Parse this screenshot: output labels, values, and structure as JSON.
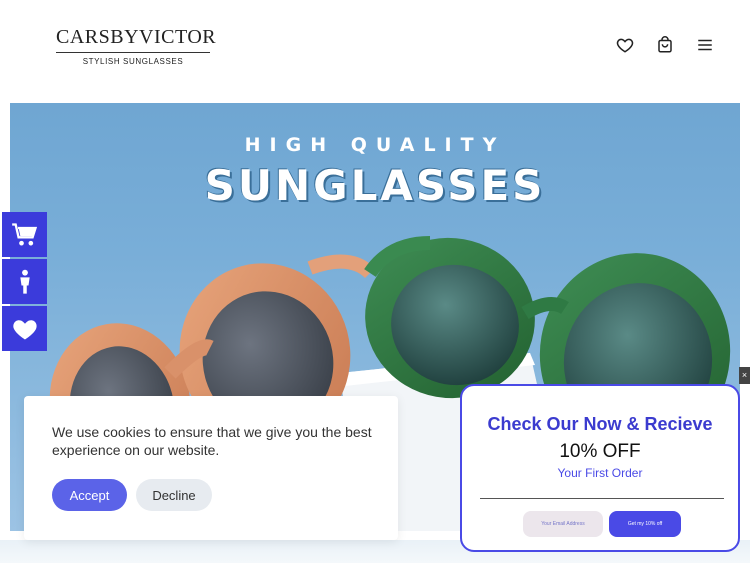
{
  "header": {
    "brand_name": "CARSBYVICTOR",
    "brand_tagline": "STYLISH SUNGLASSES",
    "icons": [
      "heart-icon",
      "shopping-bag-icon",
      "menu-icon"
    ]
  },
  "hero": {
    "subtitle": "HIGH QUALITY",
    "title": "SUNGLASSES"
  },
  "side_buttons": [
    "cart-icon",
    "accessibility-icon",
    "heart-icon"
  ],
  "cookie": {
    "text": "We use cookies to ensure that we give you the best experience on our website.",
    "accept_label": "Accept",
    "decline_label": "Decline"
  },
  "popup": {
    "title": "Check Our Now & Recieve",
    "offer": "10% OFF",
    "subtitle": "Your First Order",
    "email_placeholder": "Your Email Address",
    "submit_label": "Get my 10% off",
    "close_label": "×"
  },
  "colors": {
    "accent": "#3b3bdb",
    "button_primary": "#5b63e8",
    "hero_sky": "#7aafd8"
  }
}
